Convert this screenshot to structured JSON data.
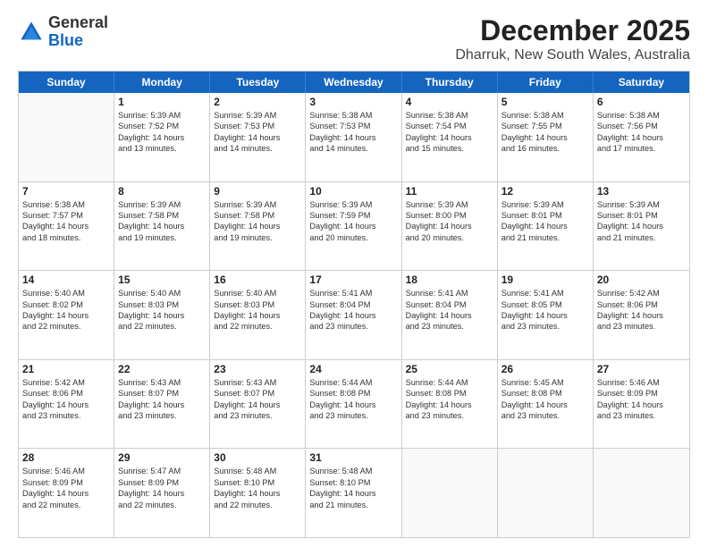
{
  "logo": {
    "general": "General",
    "blue": "Blue"
  },
  "header": {
    "title": "December 2025",
    "subtitle": "Dharruk, New South Wales, Australia"
  },
  "weekdays": [
    "Sunday",
    "Monday",
    "Tuesday",
    "Wednesday",
    "Thursday",
    "Friday",
    "Saturday"
  ],
  "rows": [
    [
      {
        "day": "",
        "lines": []
      },
      {
        "day": "1",
        "lines": [
          "Sunrise: 5:39 AM",
          "Sunset: 7:52 PM",
          "Daylight: 14 hours",
          "and 13 minutes."
        ]
      },
      {
        "day": "2",
        "lines": [
          "Sunrise: 5:39 AM",
          "Sunset: 7:53 PM",
          "Daylight: 14 hours",
          "and 14 minutes."
        ]
      },
      {
        "day": "3",
        "lines": [
          "Sunrise: 5:38 AM",
          "Sunset: 7:53 PM",
          "Daylight: 14 hours",
          "and 14 minutes."
        ]
      },
      {
        "day": "4",
        "lines": [
          "Sunrise: 5:38 AM",
          "Sunset: 7:54 PM",
          "Daylight: 14 hours",
          "and 15 minutes."
        ]
      },
      {
        "day": "5",
        "lines": [
          "Sunrise: 5:38 AM",
          "Sunset: 7:55 PM",
          "Daylight: 14 hours",
          "and 16 minutes."
        ]
      },
      {
        "day": "6",
        "lines": [
          "Sunrise: 5:38 AM",
          "Sunset: 7:56 PM",
          "Daylight: 14 hours",
          "and 17 minutes."
        ]
      }
    ],
    [
      {
        "day": "7",
        "lines": [
          "Sunrise: 5:38 AM",
          "Sunset: 7:57 PM",
          "Daylight: 14 hours",
          "and 18 minutes."
        ]
      },
      {
        "day": "8",
        "lines": [
          "Sunrise: 5:39 AM",
          "Sunset: 7:58 PM",
          "Daylight: 14 hours",
          "and 19 minutes."
        ]
      },
      {
        "day": "9",
        "lines": [
          "Sunrise: 5:39 AM",
          "Sunset: 7:58 PM",
          "Daylight: 14 hours",
          "and 19 minutes."
        ]
      },
      {
        "day": "10",
        "lines": [
          "Sunrise: 5:39 AM",
          "Sunset: 7:59 PM",
          "Daylight: 14 hours",
          "and 20 minutes."
        ]
      },
      {
        "day": "11",
        "lines": [
          "Sunrise: 5:39 AM",
          "Sunset: 8:00 PM",
          "Daylight: 14 hours",
          "and 20 minutes."
        ]
      },
      {
        "day": "12",
        "lines": [
          "Sunrise: 5:39 AM",
          "Sunset: 8:01 PM",
          "Daylight: 14 hours",
          "and 21 minutes."
        ]
      },
      {
        "day": "13",
        "lines": [
          "Sunrise: 5:39 AM",
          "Sunset: 8:01 PM",
          "Daylight: 14 hours",
          "and 21 minutes."
        ]
      }
    ],
    [
      {
        "day": "14",
        "lines": [
          "Sunrise: 5:40 AM",
          "Sunset: 8:02 PM",
          "Daylight: 14 hours",
          "and 22 minutes."
        ]
      },
      {
        "day": "15",
        "lines": [
          "Sunrise: 5:40 AM",
          "Sunset: 8:03 PM",
          "Daylight: 14 hours",
          "and 22 minutes."
        ]
      },
      {
        "day": "16",
        "lines": [
          "Sunrise: 5:40 AM",
          "Sunset: 8:03 PM",
          "Daylight: 14 hours",
          "and 22 minutes."
        ]
      },
      {
        "day": "17",
        "lines": [
          "Sunrise: 5:41 AM",
          "Sunset: 8:04 PM",
          "Daylight: 14 hours",
          "and 23 minutes."
        ]
      },
      {
        "day": "18",
        "lines": [
          "Sunrise: 5:41 AM",
          "Sunset: 8:04 PM",
          "Daylight: 14 hours",
          "and 23 minutes."
        ]
      },
      {
        "day": "19",
        "lines": [
          "Sunrise: 5:41 AM",
          "Sunset: 8:05 PM",
          "Daylight: 14 hours",
          "and 23 minutes."
        ]
      },
      {
        "day": "20",
        "lines": [
          "Sunrise: 5:42 AM",
          "Sunset: 8:06 PM",
          "Daylight: 14 hours",
          "and 23 minutes."
        ]
      }
    ],
    [
      {
        "day": "21",
        "lines": [
          "Sunrise: 5:42 AM",
          "Sunset: 8:06 PM",
          "Daylight: 14 hours",
          "and 23 minutes."
        ]
      },
      {
        "day": "22",
        "lines": [
          "Sunrise: 5:43 AM",
          "Sunset: 8:07 PM",
          "Daylight: 14 hours",
          "and 23 minutes."
        ]
      },
      {
        "day": "23",
        "lines": [
          "Sunrise: 5:43 AM",
          "Sunset: 8:07 PM",
          "Daylight: 14 hours",
          "and 23 minutes."
        ]
      },
      {
        "day": "24",
        "lines": [
          "Sunrise: 5:44 AM",
          "Sunset: 8:08 PM",
          "Daylight: 14 hours",
          "and 23 minutes."
        ]
      },
      {
        "day": "25",
        "lines": [
          "Sunrise: 5:44 AM",
          "Sunset: 8:08 PM",
          "Daylight: 14 hours",
          "and 23 minutes."
        ]
      },
      {
        "day": "26",
        "lines": [
          "Sunrise: 5:45 AM",
          "Sunset: 8:08 PM",
          "Daylight: 14 hours",
          "and 23 minutes."
        ]
      },
      {
        "day": "27",
        "lines": [
          "Sunrise: 5:46 AM",
          "Sunset: 8:09 PM",
          "Daylight: 14 hours",
          "and 23 minutes."
        ]
      }
    ],
    [
      {
        "day": "28",
        "lines": [
          "Sunrise: 5:46 AM",
          "Sunset: 8:09 PM",
          "Daylight: 14 hours",
          "and 22 minutes."
        ]
      },
      {
        "day": "29",
        "lines": [
          "Sunrise: 5:47 AM",
          "Sunset: 8:09 PM",
          "Daylight: 14 hours",
          "and 22 minutes."
        ]
      },
      {
        "day": "30",
        "lines": [
          "Sunrise: 5:48 AM",
          "Sunset: 8:10 PM",
          "Daylight: 14 hours",
          "and 22 minutes."
        ]
      },
      {
        "day": "31",
        "lines": [
          "Sunrise: 5:48 AM",
          "Sunset: 8:10 PM",
          "Daylight: 14 hours",
          "and 21 minutes."
        ]
      },
      {
        "day": "",
        "lines": []
      },
      {
        "day": "",
        "lines": []
      },
      {
        "day": "",
        "lines": []
      }
    ]
  ]
}
